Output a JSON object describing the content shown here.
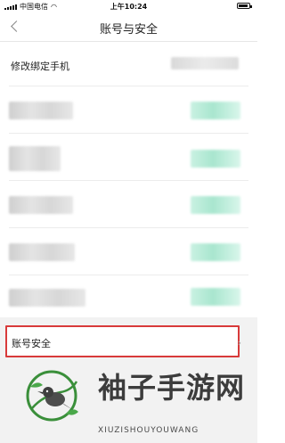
{
  "status_bar": {
    "carrier": "中国电信",
    "time": "上午10:24",
    "battery_level": 0.9
  },
  "nav": {
    "title": "账号与安全",
    "back_icon": "chevron-left-icon"
  },
  "rows": {
    "modify_phone_label": "修改绑定手机",
    "account_security_label": "账号安全"
  },
  "watermark": {
    "title": "袖子手游网",
    "subtitle": "XIUZISHOUYOUWANG"
  }
}
